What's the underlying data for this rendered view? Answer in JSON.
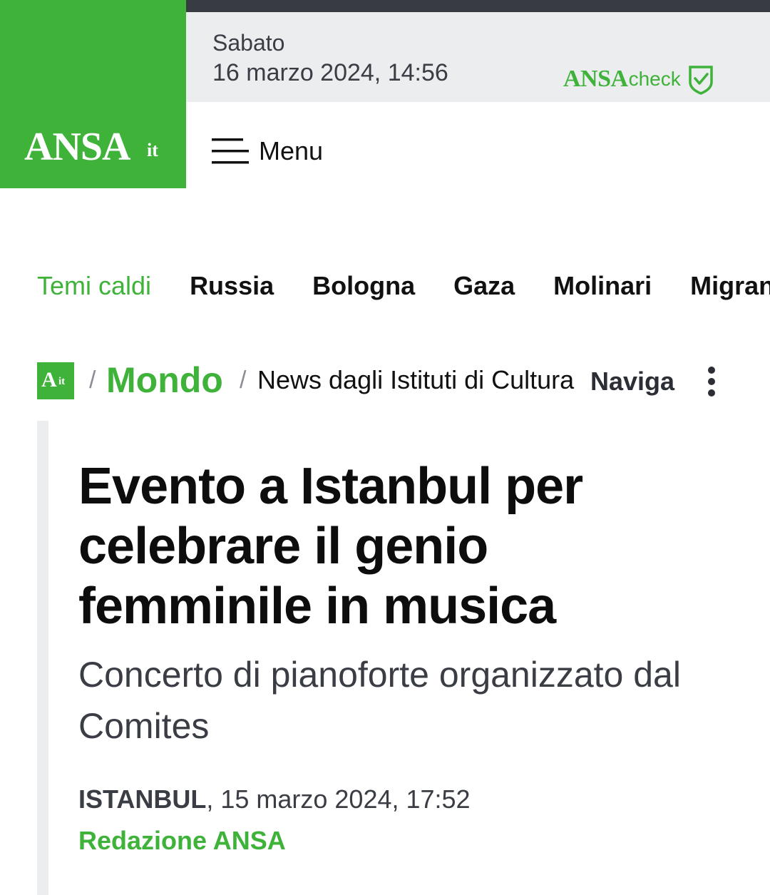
{
  "header": {
    "logo_text": "ANSA",
    "logo_suffix": "it",
    "day": "Sabato",
    "datetime": "16 marzo 2024, 14:56",
    "check_brand": "ANSA",
    "check_word": "check",
    "menu_label": "Menu",
    "brand_color": "#3fb23a"
  },
  "topics": {
    "label": "Temi caldi",
    "items": [
      "Russia",
      "Bologna",
      "Gaza",
      "Molinari",
      "Migranti"
    ]
  },
  "breadcrumb": {
    "logo_text": "A",
    "logo_suffix": "it",
    "sep1": "/",
    "section": "Mondo",
    "sep2": "/",
    "subsection": "News dagli Istituti di Cultura",
    "navigate": "Naviga"
  },
  "article": {
    "headline": "Evento a Istanbul per celebrare il genio femminile in musica",
    "subheadline": "Concerto di pianoforte organizzato dal Comites",
    "city": "ISTANBUL",
    "date": ", 15 marzo 2024, 17:52",
    "byline": "Redazione ANSA"
  }
}
